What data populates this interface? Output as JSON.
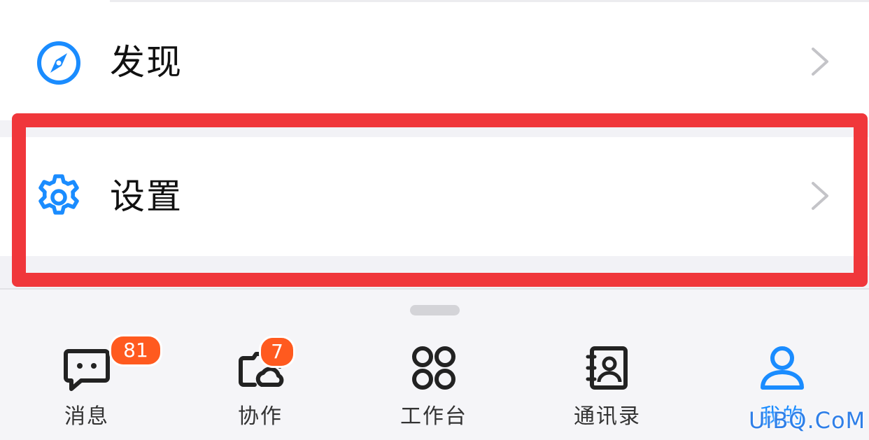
{
  "menu": {
    "items": [
      {
        "label": "发现",
        "icon": "compass-icon"
      },
      {
        "label": "设置",
        "icon": "gear-icon"
      }
    ]
  },
  "tabbar": {
    "tabs": [
      {
        "label": "消息",
        "icon": "chat-icon",
        "badge": "81"
      },
      {
        "label": "协作",
        "icon": "collab-cloud-icon",
        "badge": "7"
      },
      {
        "label": "工作台",
        "icon": "workbench-grid-icon"
      },
      {
        "label": "通讯录",
        "icon": "contacts-book-icon"
      },
      {
        "label": "我的",
        "icon": "user-icon",
        "active": true
      }
    ]
  },
  "watermark": "UiBQ.CoM",
  "colors": {
    "accent": "#1a8cff",
    "highlight": "#f0373b",
    "badge": "#ff5a1f",
    "tab_bg": "#f5f5f8"
  }
}
